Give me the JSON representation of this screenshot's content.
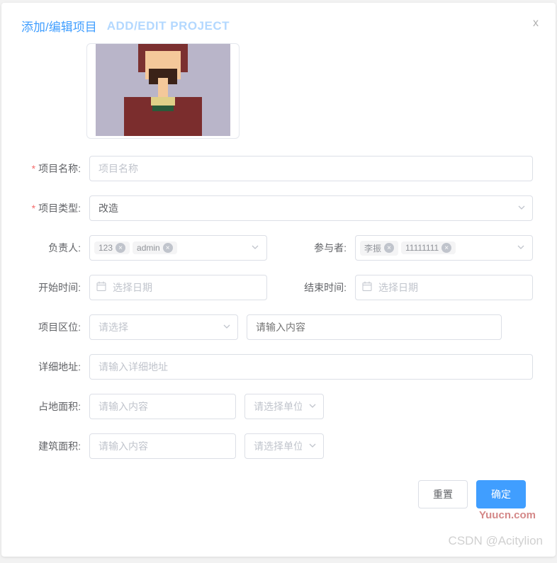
{
  "header": {
    "title_cn": "添加/编辑项目",
    "title_en": "ADD/EDIT PROJECT",
    "close": "x"
  },
  "form": {
    "project_name": {
      "label": "项目名称:",
      "placeholder": "项目名称",
      "value": ""
    },
    "project_type": {
      "label": "项目类型:",
      "value": "改造"
    },
    "owner": {
      "label": "负责人:",
      "tags": [
        "123",
        "admin"
      ]
    },
    "participant": {
      "label": "参与者:",
      "tags": [
        "李振",
        "11111111"
      ]
    },
    "start_time": {
      "label": "开始时间:",
      "placeholder": "选择日期"
    },
    "end_time": {
      "label": "结束时间:",
      "placeholder": "选择日期"
    },
    "area": {
      "label": "项目区位:",
      "select_placeholder": "请选择",
      "input_placeholder": "请输入内容"
    },
    "address": {
      "label": "详细地址:",
      "placeholder": "请输入详细地址"
    },
    "land_area": {
      "label": "占地面积:",
      "input_placeholder": "请输入内容",
      "unit_placeholder": "请选择单位"
    },
    "build_area": {
      "label": "建筑面积:",
      "input_placeholder": "请输入内容",
      "unit_placeholder": "请选择单位"
    }
  },
  "buttons": {
    "reset": "重置",
    "confirm": "确定"
  },
  "watermark": {
    "line1": "Yuucn.com",
    "line2": "CSDN @Acitylion"
  }
}
